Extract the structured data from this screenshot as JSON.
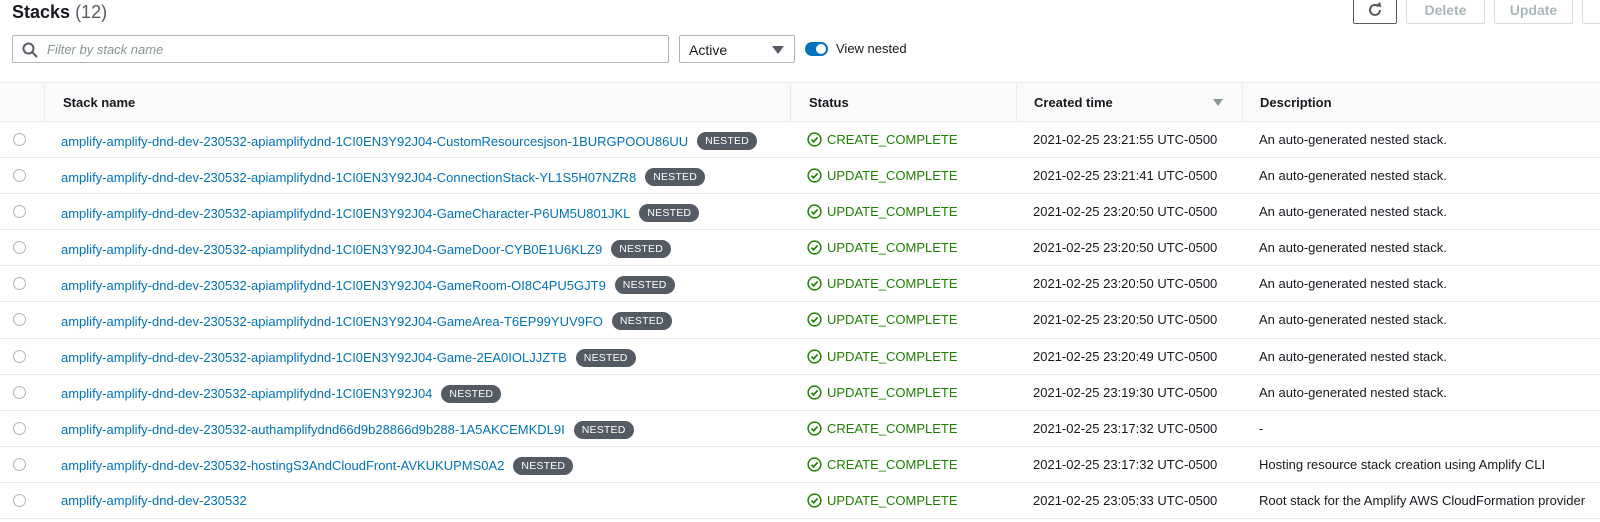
{
  "header": {
    "title": "Stacks",
    "count": "(12)",
    "delete_label": "Delete",
    "update_label": "Update"
  },
  "filters": {
    "search_placeholder": "Filter by stack name",
    "status_select": "Active",
    "view_nested_label": "View nested",
    "view_nested_on": true
  },
  "table": {
    "columns": [
      "Stack name",
      "Status",
      "Created time",
      "Description"
    ],
    "rows": [
      {
        "name": "amplify-amplify-dnd-dev-230532-apiamplifydnd-1CI0EN3Y92J04-CustomResourcesjson-1BURGPOOU86UU",
        "badge": "NESTED",
        "status": "CREATE_COMPLETE",
        "created": "2021-02-25 23:21:55 UTC-0500",
        "description": "An auto-generated nested stack."
      },
      {
        "name": "amplify-amplify-dnd-dev-230532-apiamplifydnd-1CI0EN3Y92J04-ConnectionStack-YL1S5H07NZR8",
        "badge": "NESTED",
        "status": "UPDATE_COMPLETE",
        "created": "2021-02-25 23:21:41 UTC-0500",
        "description": "An auto-generated nested stack."
      },
      {
        "name": "amplify-amplify-dnd-dev-230532-apiamplifydnd-1CI0EN3Y92J04-GameCharacter-P6UM5U801JKL",
        "badge": "NESTED",
        "status": "UPDATE_COMPLETE",
        "created": "2021-02-25 23:20:50 UTC-0500",
        "description": "An auto-generated nested stack."
      },
      {
        "name": "amplify-amplify-dnd-dev-230532-apiamplifydnd-1CI0EN3Y92J04-GameDoor-CYB0E1U6KLZ9",
        "badge": "NESTED",
        "status": "UPDATE_COMPLETE",
        "created": "2021-02-25 23:20:50 UTC-0500",
        "description": "An auto-generated nested stack."
      },
      {
        "name": "amplify-amplify-dnd-dev-230532-apiamplifydnd-1CI0EN3Y92J04-GameRoom-OI8C4PU5GJT9",
        "badge": "NESTED",
        "status": "UPDATE_COMPLETE",
        "created": "2021-02-25 23:20:50 UTC-0500",
        "description": "An auto-generated nested stack."
      },
      {
        "name": "amplify-amplify-dnd-dev-230532-apiamplifydnd-1CI0EN3Y92J04-GameArea-T6EP99YUV9FO",
        "badge": "NESTED",
        "status": "UPDATE_COMPLETE",
        "created": "2021-02-25 23:20:50 UTC-0500",
        "description": "An auto-generated nested stack."
      },
      {
        "name": "amplify-amplify-dnd-dev-230532-apiamplifydnd-1CI0EN3Y92J04-Game-2EA0IOLJJZTB",
        "badge": "NESTED",
        "status": "UPDATE_COMPLETE",
        "created": "2021-02-25 23:20:49 UTC-0500",
        "description": "An auto-generated nested stack."
      },
      {
        "name": "amplify-amplify-dnd-dev-230532-apiamplifydnd-1CI0EN3Y92J04",
        "badge": "NESTED",
        "status": "UPDATE_COMPLETE",
        "created": "2021-02-25 23:19:30 UTC-0500",
        "description": "An auto-generated nested stack."
      },
      {
        "name": "amplify-amplify-dnd-dev-230532-authamplifydnd66d9b28866d9b288-1A5AKCEMKDL9I",
        "badge": "NESTED",
        "status": "CREATE_COMPLETE",
        "created": "2021-02-25 23:17:32 UTC-0500",
        "description": "-"
      },
      {
        "name": "amplify-amplify-dnd-dev-230532-hostingS3AndCloudFront-AVKUKUPMS0A2",
        "badge": "NESTED",
        "status": "CREATE_COMPLETE",
        "created": "2021-02-25 23:17:32 UTC-0500",
        "description": "Hosting resource stack creation using Amplify CLI"
      },
      {
        "name": "amplify-amplify-dnd-dev-230532",
        "badge": "",
        "status": "UPDATE_COMPLETE",
        "created": "2021-02-25 23:05:33 UTC-0500",
        "description": "Root stack for the Amplify AWS CloudFormation provider"
      }
    ]
  },
  "colors": {
    "link": "#0073bb",
    "success": "#1d8102",
    "badge_bg": "#545b64"
  },
  "icons": {
    "refresh": "refresh-icon",
    "search": "search-icon",
    "status": "check-circle-icon",
    "sort": "sort-down-icon"
  }
}
